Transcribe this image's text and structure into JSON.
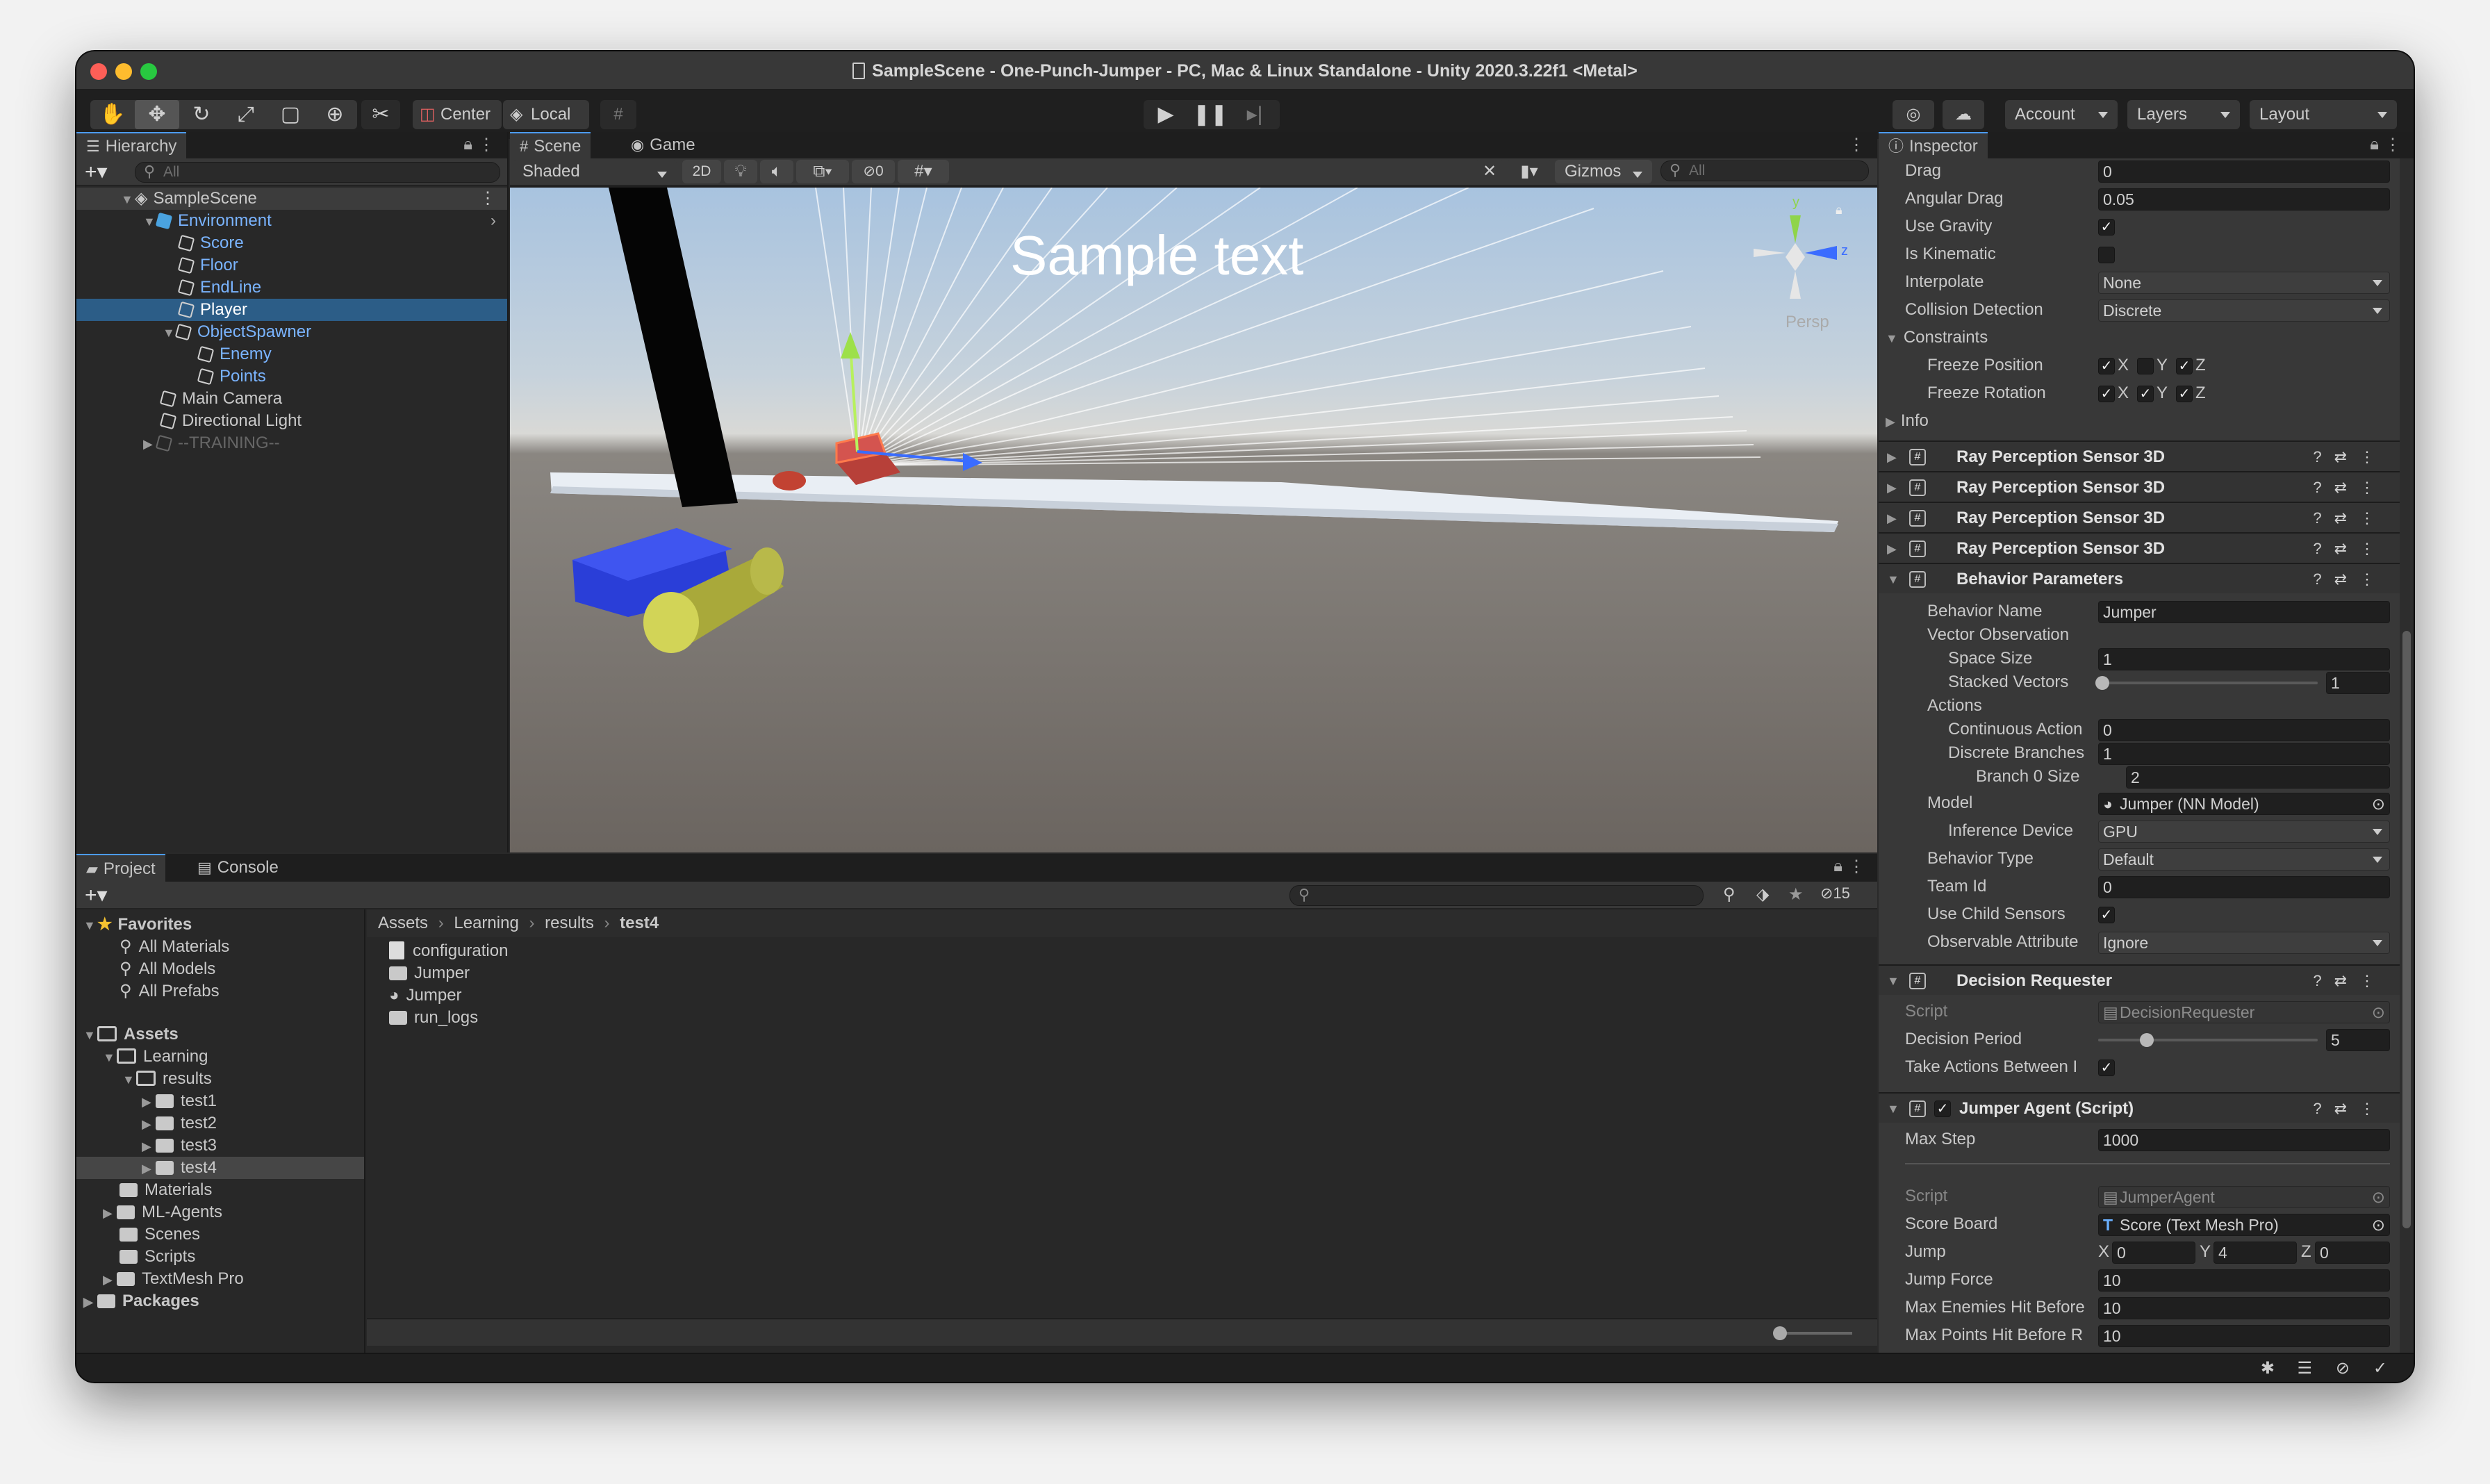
{
  "window": {
    "title": "SampleScene - One-Punch-Jumper - PC, Mac & Linux Standalone - Unity 2020.3.22f1 <Metal>"
  },
  "toolbar": {
    "pivot_label": "Center",
    "space_label": "Local",
    "account_label": "Account",
    "layers_label": "Layers",
    "layout_label": "Layout"
  },
  "hierarchy": {
    "tab_label": "Hierarchy",
    "search_placeholder": "All",
    "items": [
      {
        "label": "SampleScene"
      },
      {
        "label": "Environment"
      },
      {
        "label": "Score"
      },
      {
        "label": "Floor"
      },
      {
        "label": "EndLine"
      },
      {
        "label": "Player"
      },
      {
        "label": "ObjectSpawner"
      },
      {
        "label": "Enemy"
      },
      {
        "label": "Points"
      },
      {
        "label": "Main Camera"
      },
      {
        "label": "Directional Light"
      },
      {
        "label": "--TRAINING--"
      }
    ]
  },
  "scene": {
    "tab_scene": "Scene",
    "tab_game": "Game",
    "shading_mode": "Shaded",
    "mode_2d": "2D",
    "hidden_count": "0",
    "gizmos_label": "Gizmos",
    "search_placeholder": "All",
    "overlay_text": "Sample text",
    "persp_label": "Persp",
    "axis_y": "y",
    "axis_z": "z"
  },
  "project": {
    "tab_project": "Project",
    "tab_console": "Console",
    "hidden_count": "15",
    "tree": [
      {
        "label": "Favorites"
      },
      {
        "label": "All Materials"
      },
      {
        "label": "All Models"
      },
      {
        "label": "All Prefabs"
      },
      {
        "label": "Assets"
      },
      {
        "label": "Learning"
      },
      {
        "label": "results"
      },
      {
        "label": "test1"
      },
      {
        "label": "test2"
      },
      {
        "label": "test3"
      },
      {
        "label": "test4"
      },
      {
        "label": "Materials"
      },
      {
        "label": "ML-Agents"
      },
      {
        "label": "Scenes"
      },
      {
        "label": "Scripts"
      },
      {
        "label": "TextMesh Pro"
      },
      {
        "label": "Packages"
      }
    ],
    "breadcrumb": [
      "Assets",
      "Learning",
      "results",
      "test4"
    ],
    "files": [
      {
        "label": "configuration"
      },
      {
        "label": "Jumper"
      },
      {
        "label": "Jumper"
      },
      {
        "label": "run_logs"
      }
    ]
  },
  "inspector": {
    "tab_label": "Inspector",
    "rigidbody": {
      "drag_label": "Drag",
      "drag": "0",
      "angular_drag_label": "Angular Drag",
      "angular_drag": "0.05",
      "use_gravity_label": "Use Gravity",
      "is_kinematic_label": "Is Kinematic",
      "interpolate_label": "Interpolate",
      "interpolate": "None",
      "collision_label": "Collision Detection",
      "collision": "Discrete",
      "constraints_label": "Constraints",
      "freeze_pos_label": "Freeze Position",
      "freeze_rot_label": "Freeze Rotation",
      "axis_x": "X",
      "axis_y": "Y",
      "axis_z": "Z",
      "info_label": "Info"
    },
    "ray_sensor_title": "Ray Perception Sensor 3D",
    "behavior": {
      "title": "Behavior Parameters",
      "name_label": "Behavior Name",
      "name": "Jumper",
      "vector_obs_label": "Vector Observation",
      "space_size_label": "Space Size",
      "space_size": "1",
      "stacked_label": "Stacked Vectors",
      "stacked": "1",
      "actions_label": "Actions",
      "continuous_label": "Continuous Action",
      "continuous": "0",
      "discrete_label": "Discrete Branches",
      "discrete": "1",
      "branch0_label": "Branch 0 Size",
      "branch0": "2",
      "model_label": "Model",
      "model": "Jumper (NN Model)",
      "inference_label": "Inference Device",
      "inference": "GPU",
      "type_label": "Behavior Type",
      "type": "Default",
      "team_label": "Team Id",
      "team": "0",
      "child_sensors_label": "Use Child Sensors",
      "observable_label": "Observable Attribute",
      "observable": "Ignore"
    },
    "decision": {
      "title": "Decision Requester",
      "script_label": "Script",
      "script": "DecisionRequester",
      "period_label": "Decision Period",
      "period": "5",
      "take_actions_label": "Take Actions Between I"
    },
    "agent": {
      "title": "Jumper Agent (Script)",
      "max_step_label": "Max Step",
      "max_step": "1000",
      "script_label": "Script",
      "script": "JumperAgent",
      "score_board_label": "Score Board",
      "score_board": "Score (Text Mesh Pro)",
      "jump_label": "Jump",
      "jump_x": "0",
      "jump_y": "4",
      "jump_z": "0",
      "jump_force_label": "Jump Force",
      "jump_force": "10",
      "max_enemies_label": "Max Enemies Hit Before",
      "max_enemies": "10",
      "max_points_label": "Max Points Hit Before R",
      "max_points": "10"
    }
  },
  "colors": {
    "selection": "#2c5d87",
    "accent": "#4c9bff",
    "close": "#fe5f57",
    "minimize": "#febc2e",
    "zoom": "#28c840"
  }
}
